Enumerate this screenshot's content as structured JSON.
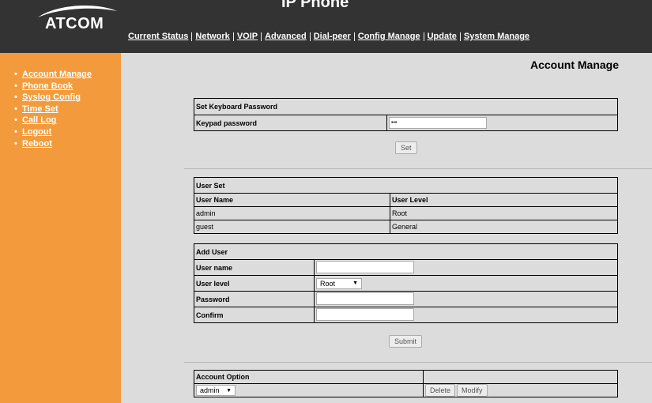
{
  "app": {
    "logo_text": "ATCOM",
    "title": "IP Phone"
  },
  "topnav": [
    "Current Status",
    "Network",
    "VOIP",
    "Advanced",
    "Dial-peer",
    "Config Manage",
    "Update",
    "System Manage"
  ],
  "sidebar": {
    "items": [
      "Account Manage",
      "Phone Book",
      "Syslog Config",
      "Time Set",
      "Call Log",
      "Logout",
      "Reboot"
    ]
  },
  "page": {
    "title": "Account Manage"
  },
  "keyboard": {
    "section_title": "Set Keyboard Password",
    "label": "Keypad password",
    "value": "•••",
    "set_label": "Set"
  },
  "user_set": {
    "section_title": "User Set",
    "columns": [
      "User Name",
      "User Level"
    ],
    "rows": [
      [
        "admin",
        "Root"
      ],
      [
        "guest",
        "General"
      ]
    ]
  },
  "add_user": {
    "section_title": "Add User",
    "username_label": "User name",
    "level_label": "User level",
    "level_value": "Root",
    "password_label": "Password",
    "confirm_label": "Confirm",
    "submit_label": "Submit"
  },
  "account_option": {
    "section_title": "Account Option",
    "select_value": "admin",
    "delete_label": "Delete",
    "modify_label": "Modify"
  },
  "colors": {
    "header": "#333333",
    "sidebar": "#f39b3c",
    "content": "#dcdcdc"
  }
}
